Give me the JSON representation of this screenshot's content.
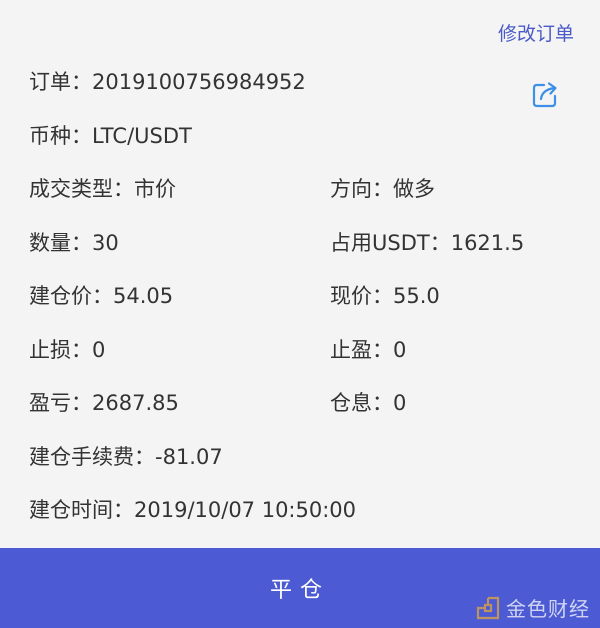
{
  "header": {
    "edit_order_label": "修改订单"
  },
  "order": {
    "order_label": "订单：",
    "order_id": "2019100756984952",
    "pair_label": "币种：",
    "pair": "LTC/USDT",
    "trade_type_label": "成交类型：",
    "trade_type": "市价",
    "direction_label": "方向：",
    "direction": "做多",
    "quantity_label": "数量：",
    "quantity": "30",
    "margin_label": "占用USDT：",
    "margin": "1621.5",
    "open_price_label": "建仓价：",
    "open_price": "54.05",
    "current_price_label": "现价：",
    "current_price": "55.0",
    "stop_loss_label": "止损：",
    "stop_loss": "0",
    "take_profit_label": "止盈：",
    "take_profit": "0",
    "pnl_label": "盈亏：",
    "pnl": "2687.85",
    "position_interest_label": "仓息：",
    "position_interest": "0",
    "open_fee_label": "建仓手续费：",
    "open_fee": "-81.07",
    "open_time_label": "建仓时间：",
    "open_time": "2019/10/07 10:50:00"
  },
  "footer": {
    "close_position_label": "平仓"
  },
  "watermark": {
    "text": "金色财经",
    "logo_icon": "golden-finance-logo-icon"
  },
  "colors": {
    "accent": "#4c5bd3",
    "link": "#4a5bc7",
    "share_icon": "#3d8fe8"
  }
}
